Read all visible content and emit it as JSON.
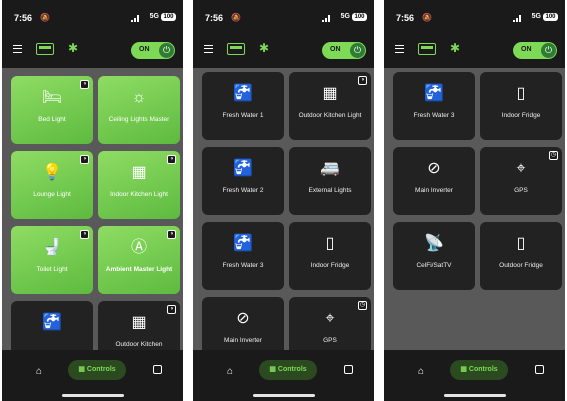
{
  "colors": {
    "accent": "#7ed957",
    "background": "#1a1a1a",
    "grid_bg": "#595959",
    "card": "#222222"
  },
  "status": {
    "time": "7:56",
    "network": "5G",
    "battery": "100"
  },
  "header": {
    "toggle_label": "ON"
  },
  "nav": {
    "controls_label": "Controls"
  },
  "screens": [
    {
      "cards": [
        {
          "label": "Bed Light",
          "icon": "bed-light-icon",
          "glyph": "🛏",
          "on": true,
          "badge": "◑"
        },
        {
          "label": "Ceiling Lights Master",
          "icon": "ceiling-light-icon",
          "glyph": "☼",
          "on": true,
          "badge": ""
        },
        {
          "label": "Lounge Light",
          "icon": "lamp-icon",
          "glyph": "💡",
          "on": true,
          "badge": "◑"
        },
        {
          "label": "Indoor Kitchen Light",
          "icon": "kitchen-icon",
          "glyph": "▦",
          "on": true,
          "badge": "◑"
        },
        {
          "label": "Toilet Light",
          "icon": "toilet-icon",
          "glyph": "🚽",
          "on": true,
          "badge": "◑"
        },
        {
          "label": "Ambient Master Light",
          "icon": "ambient-light-icon",
          "glyph": "Ⓐ",
          "on": true,
          "badge": "◑",
          "bold": true
        },
        {
          "label": "",
          "icon": "faucet-icon",
          "glyph": "🚰",
          "on": false,
          "badge": ""
        },
        {
          "label": "Outdoor Kitchen",
          "icon": "kitchen-icon",
          "glyph": "▦",
          "on": false,
          "badge": "◑"
        }
      ]
    },
    {
      "cards": [
        {
          "label": "Fresh Water 1",
          "icon": "faucet-icon",
          "glyph": "🚰",
          "on": false,
          "badge": ""
        },
        {
          "label": "Outdoor Kitchen Light",
          "icon": "kitchen-icon",
          "glyph": "▦",
          "on": false,
          "badge": "◑"
        },
        {
          "label": "Fresh Water 2",
          "icon": "faucet-icon",
          "glyph": "🚰",
          "on": false,
          "badge": ""
        },
        {
          "label": "External Lights",
          "icon": "van-lights-icon",
          "glyph": "🚐",
          "on": false,
          "badge": ""
        },
        {
          "label": "Fresh Water 3",
          "icon": "faucet-icon",
          "glyph": "🚰",
          "on": false,
          "badge": ""
        },
        {
          "label": "Indoor Fridge",
          "icon": "fridge-icon",
          "glyph": "▯",
          "on": false,
          "badge": ""
        },
        {
          "label": "Main Inverter",
          "icon": "inverter-icon",
          "glyph": "⊘",
          "on": false,
          "badge": ""
        },
        {
          "label": "GPS",
          "icon": "gps-icon",
          "glyph": "⌖",
          "on": false,
          "badge": "◷"
        }
      ]
    },
    {
      "cards": [
        {
          "label": "Fresh Water 3",
          "icon": "faucet-icon",
          "glyph": "🚰",
          "on": false,
          "badge": ""
        },
        {
          "label": "Indoor Fridge",
          "icon": "fridge-icon",
          "glyph": "▯",
          "on": false,
          "badge": ""
        },
        {
          "label": "Main Inverter",
          "icon": "inverter-icon",
          "glyph": "⊘",
          "on": false,
          "badge": ""
        },
        {
          "label": "GPS",
          "icon": "gps-icon",
          "glyph": "⌖",
          "on": false,
          "badge": "◷"
        },
        {
          "label": "CelFi/SatTV",
          "icon": "satellite-dish-icon",
          "glyph": "📡",
          "on": false,
          "badge": ""
        },
        {
          "label": "Outdoor Fridge",
          "icon": "fridge-icon",
          "glyph": "▯",
          "on": false,
          "badge": ""
        }
      ]
    }
  ]
}
